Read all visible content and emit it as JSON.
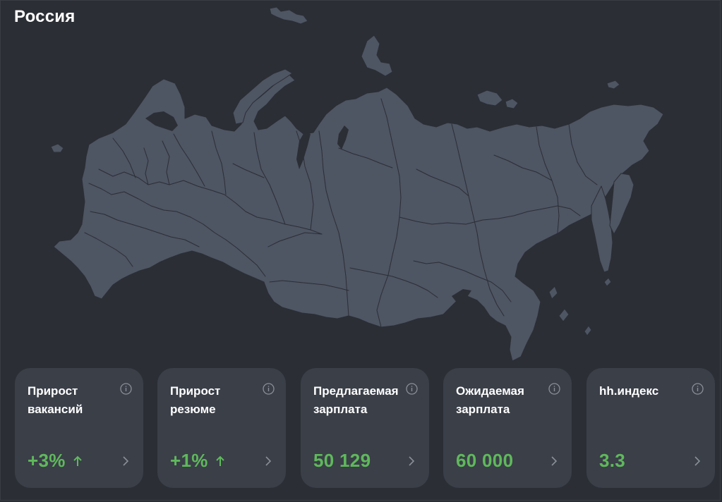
{
  "page": {
    "title": "Россия"
  },
  "map": {
    "region": "Россия",
    "fill_color": "#4e5563",
    "border_color": "#2b2e35"
  },
  "colors": {
    "background": "#2b2e35",
    "card": "#3a3f48",
    "accent_green": "#5fb95b",
    "icon_gray": "#8a8f98"
  },
  "cards": [
    {
      "label": "Прирост вакансий",
      "value": "+3%",
      "trend": "up",
      "info_icon": "info-icon",
      "chevron_icon": "chevron-right-icon"
    },
    {
      "label": "Прирост резюме",
      "value": "+1%",
      "trend": "up",
      "info_icon": "info-icon",
      "chevron_icon": "chevron-right-icon"
    },
    {
      "label": "Предлагаемая зарплата",
      "value": "50 129",
      "trend": null,
      "info_icon": "info-icon",
      "chevron_icon": "chevron-right-icon"
    },
    {
      "label": "Ожидаемая зарплата",
      "value": "60 000",
      "trend": null,
      "info_icon": "info-icon",
      "chevron_icon": "chevron-right-icon"
    },
    {
      "label": "hh.индекс",
      "value": "3.3",
      "trend": null,
      "info_icon": "info-icon",
      "chevron_icon": "chevron-right-icon"
    }
  ]
}
